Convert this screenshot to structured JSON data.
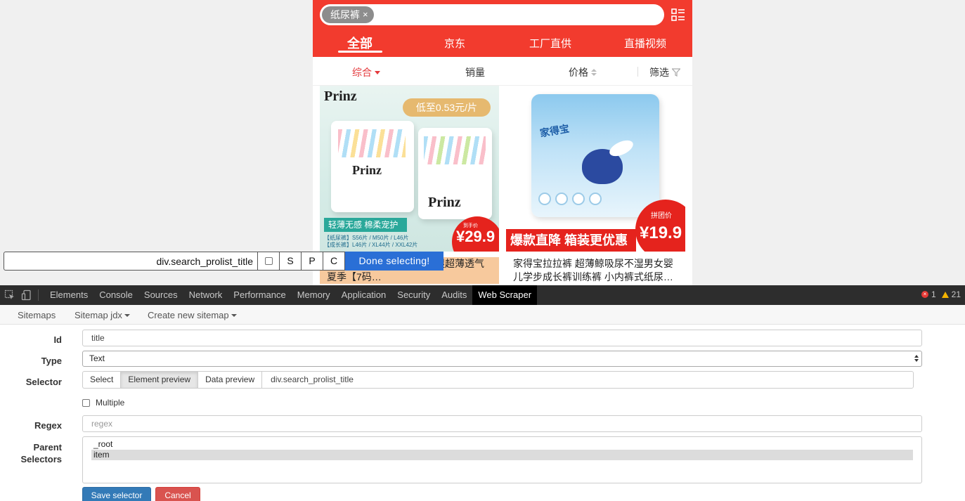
{
  "page": {
    "search": {
      "tag": "纸尿裤",
      "tag_close": "×"
    },
    "tabs": [
      {
        "label": "全部"
      },
      {
        "label": "京东"
      },
      {
        "label": "工厂直供"
      },
      {
        "label": "直播视频"
      }
    ],
    "sort": {
      "composite": "综合",
      "sales": "销量",
      "price": "价格",
      "filter": "筛选"
    },
    "products": [
      {
        "image_brand": "Prinz",
        "image_badge": "低至0.53元/片",
        "image_slogan": "轻薄无感 棉柔宠护",
        "image_sizes_1": "【纸尿裤】S56片 / M50片 / L46片",
        "image_sizes_2": "【成长裤】L46片 / XL44片 / XXL42片",
        "image_price_label": "到手价",
        "image_price": "¥29.9",
        "title": "女宝宝通用大码婴儿尿不湿超薄透气夏季【7码…"
      },
      {
        "image_brand": "家得宝",
        "image_promo": "爆款直降 箱装更优惠",
        "image_price_label": "拼团价",
        "image_price": "¥19.9",
        "title": "家得宝拉拉裤 超薄鲸吸尿不湿男女婴儿学步成长裤训练裤 小内裤式纸尿…"
      }
    ]
  },
  "selector_bar": {
    "value": "div.search_prolist_title",
    "btn_s": "S",
    "btn_p": "P",
    "btn_c": "C",
    "done": "Done selecting!"
  },
  "devtools": {
    "tabs": [
      "Elements",
      "Console",
      "Sources",
      "Network",
      "Performance",
      "Memory",
      "Application",
      "Security",
      "Audits",
      "Web Scraper"
    ],
    "active_tab": "Web Scraper",
    "errors": "1",
    "warnings": "21"
  },
  "scraper_nav": {
    "sitemaps": "Sitemaps",
    "sitemap": "Sitemap jdx",
    "create": "Create new sitemap"
  },
  "form": {
    "id_label": "Id",
    "id_value": "title",
    "type_label": "Type",
    "type_value": "Text",
    "selector_label": "Selector",
    "select_btn": "Select",
    "element_preview_btn": "Element preview",
    "data_preview_btn": "Data preview",
    "selector_value": "div.search_prolist_title",
    "multiple_label": "Multiple",
    "regex_label": "Regex",
    "regex_placeholder": "regex",
    "parent_label_1": "Parent",
    "parent_label_2": "Selectors",
    "parent_options": [
      "_root",
      "item"
    ],
    "save": "Save selector",
    "cancel": "Cancel"
  },
  "colors": {
    "header_red": "#f23b2e",
    "active_sort": "#e4393c",
    "done_button": "#2a6fd6",
    "save_button": "#337ab7",
    "cancel_button": "#d9534f"
  }
}
